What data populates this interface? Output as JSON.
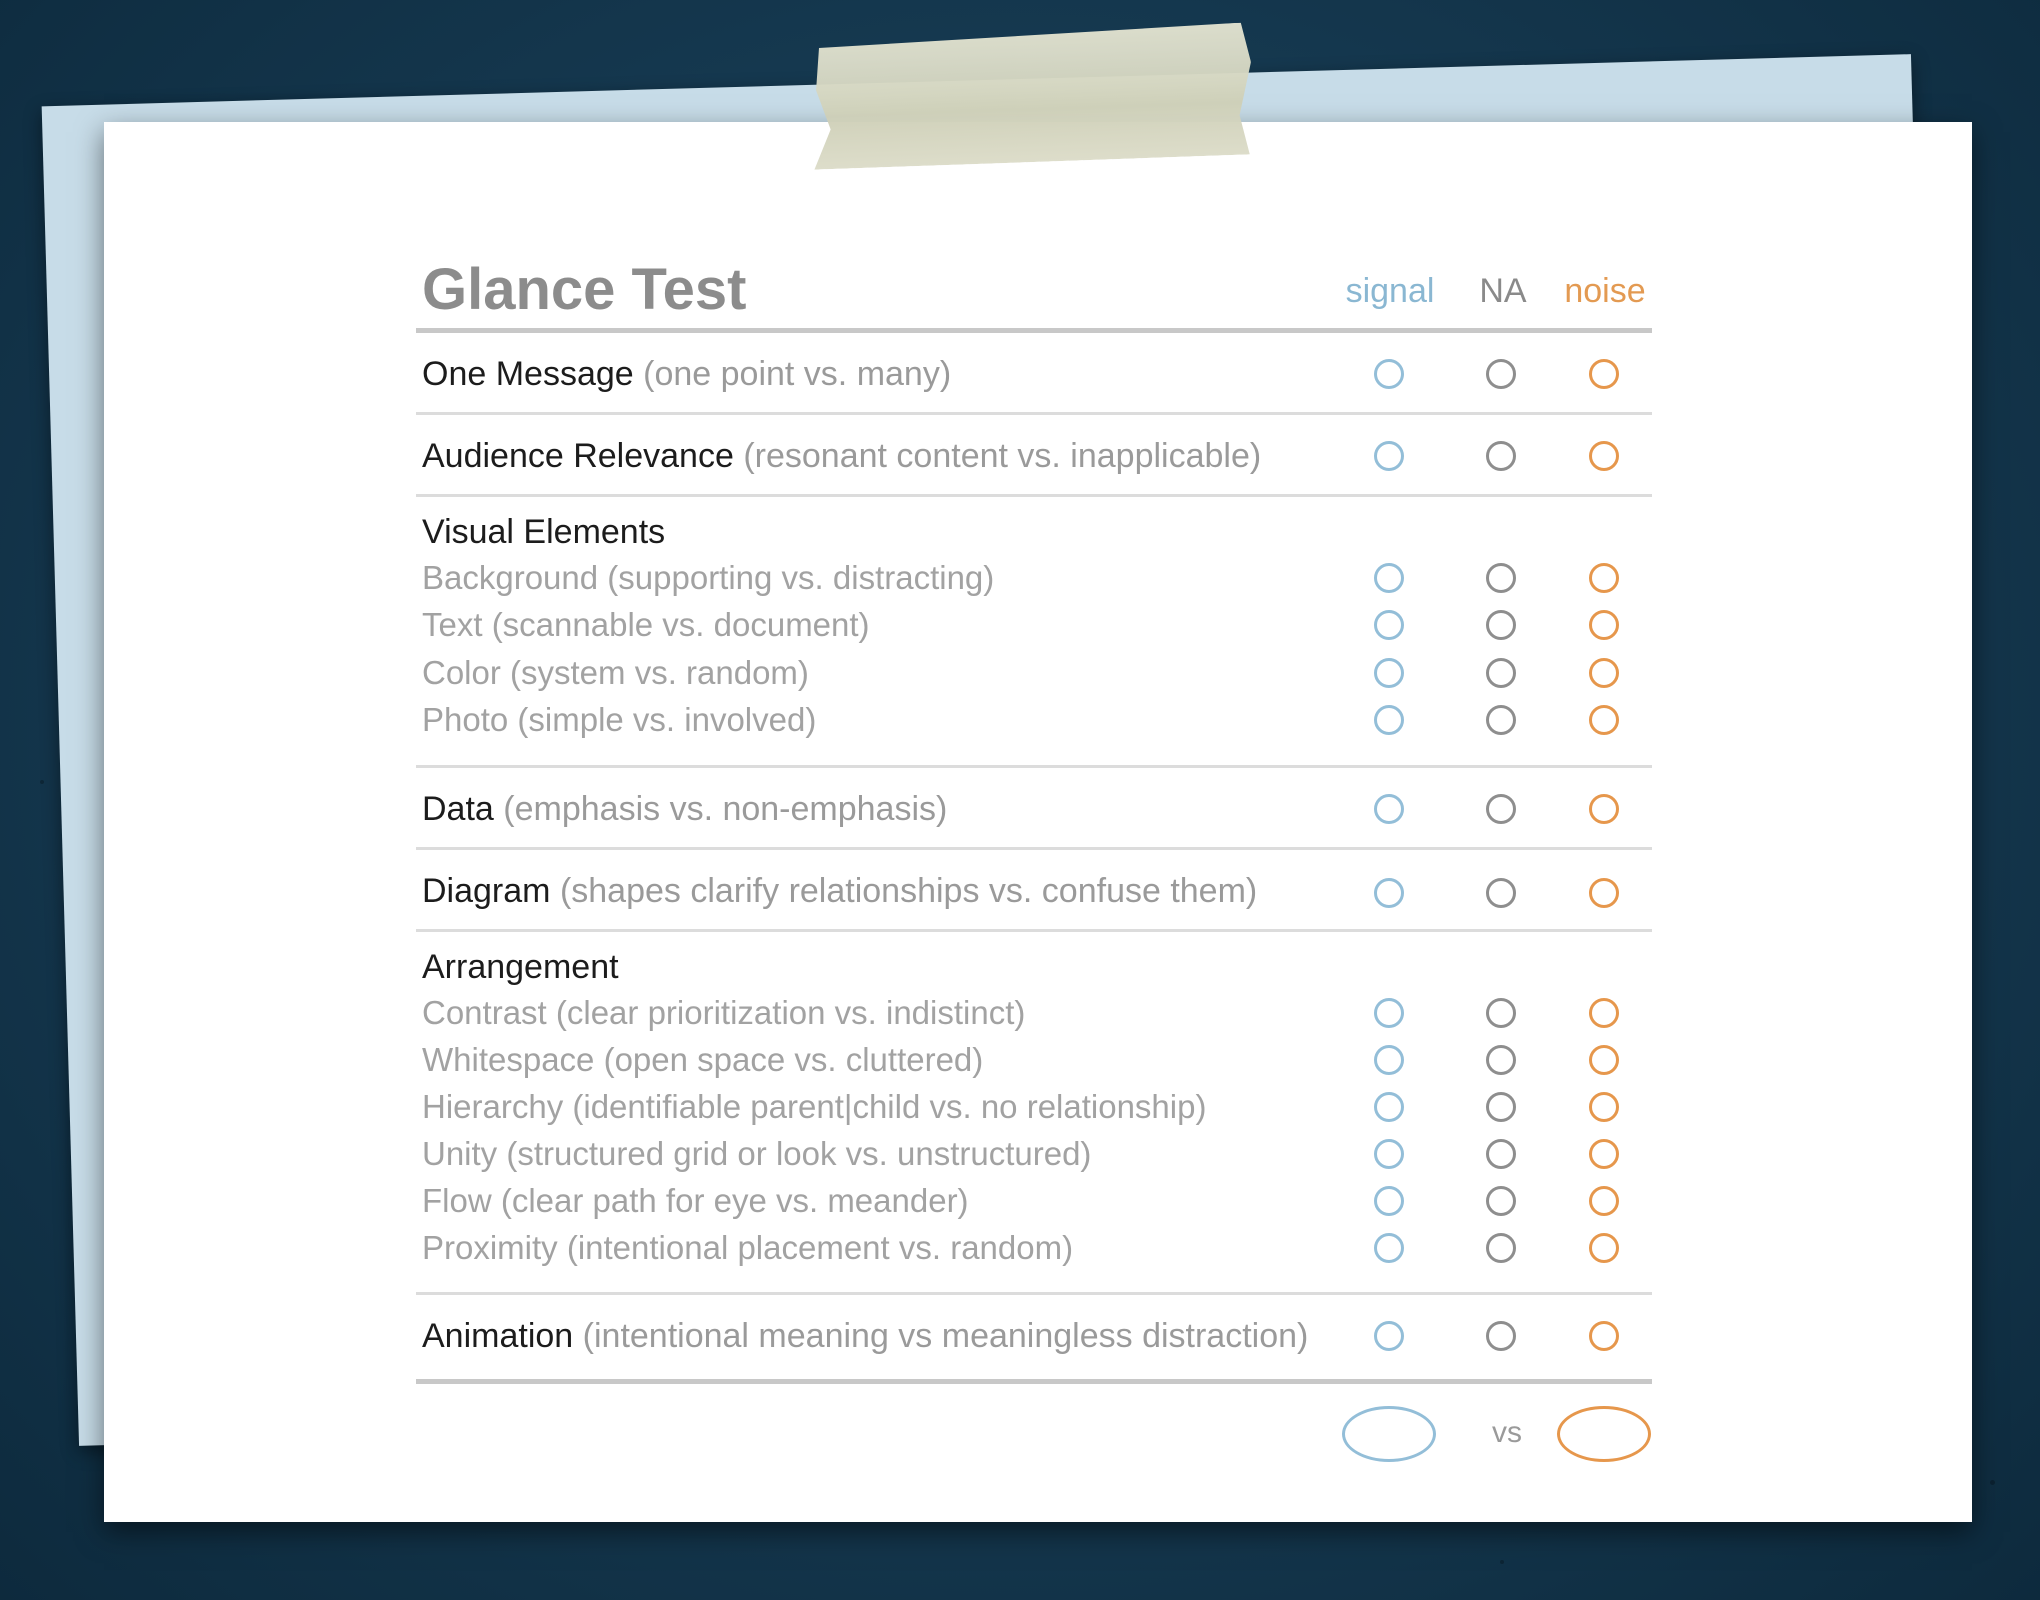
{
  "card": {
    "title": "Glance Test",
    "columns": {
      "signal": "signal",
      "na": "NA",
      "noise": "noise"
    },
    "colors": {
      "signal": "#93bed8",
      "na": "#8e8e8e",
      "noise": "#e6974c"
    }
  },
  "rows": [
    {
      "name": "One Message",
      "desc": "(one point vs. many)"
    },
    {
      "name": "Audience Relevance",
      "desc": "(resonant content vs. inapplicable)"
    }
  ],
  "visual_elements": {
    "title": "Visual Elements",
    "items": [
      "Background (supporting vs. distracting)",
      "Text (scannable vs. document)",
      "Color (system vs. random)",
      "Photo (simple vs. involved)"
    ]
  },
  "data_row": {
    "name": "Data",
    "desc": "(emphasis vs. non-emphasis)"
  },
  "diagram_row": {
    "name": "Diagram",
    "desc": "(shapes clarify relationships vs. confuse them)"
  },
  "arrangement": {
    "title": "Arrangement",
    "items": [
      "Contrast (clear prioritization vs. indistinct)",
      "Whitespace (open space vs. cluttered)",
      "Hierarchy (identifiable parent|child vs. no relationship)",
      "Unity (structured grid or look vs. unstructured)",
      "Flow (clear path for eye vs. meander)",
      "Proximity (intentional placement vs. random)"
    ]
  },
  "animation_row": {
    "name": "Animation",
    "desc": "(intentional meaning vs meaningless distraction)"
  },
  "footer": {
    "vs": "vs"
  }
}
